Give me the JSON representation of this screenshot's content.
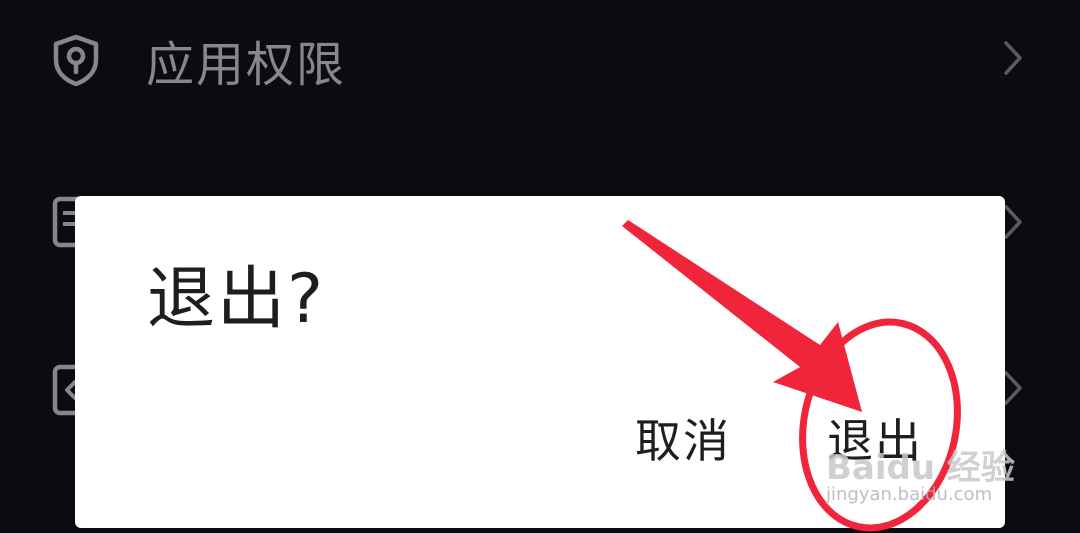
{
  "settings_list": {
    "items": [
      {
        "label": "应用权限",
        "icon": "shield-icon"
      },
      {
        "label": "",
        "icon": "document-icon"
      },
      {
        "label": "",
        "icon": "code-icon"
      }
    ]
  },
  "dialog": {
    "title": "退出?",
    "cancel_label": "取消",
    "confirm_label": "退出"
  },
  "watermark": {
    "brand": "Baidu 经验",
    "url": "jingyan.baidu.com"
  },
  "colors": {
    "background": "#0b0b10",
    "row_text": "#86878c",
    "dialog_bg": "#ffffff",
    "dialog_text": "#1d1d22",
    "annotation_red": "#f0243a"
  }
}
